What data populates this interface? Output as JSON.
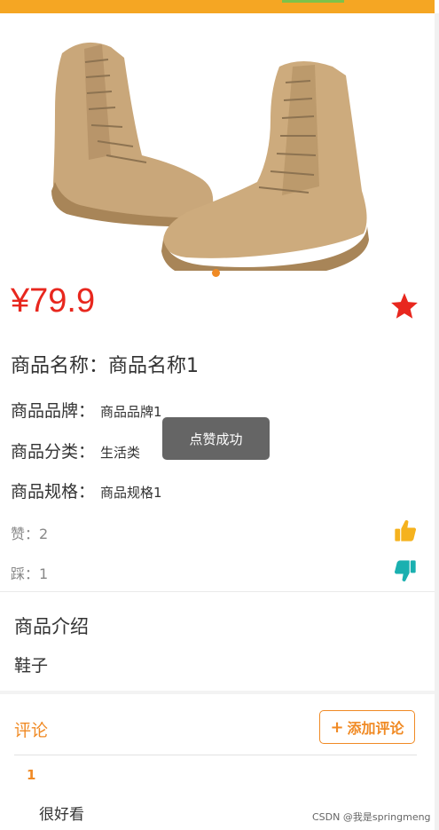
{
  "colors": {
    "accent_orange": "#f08a24",
    "price_red": "#e8271e",
    "like_yellow": "#f5b21e",
    "dislike_teal": "#1ab0b0",
    "star_red": "#e8271e"
  },
  "product": {
    "price": "¥79.9",
    "name_label": "商品名称：",
    "name_value": "商品名称1",
    "brand_label": "商品品牌：",
    "brand_value": "商品品牌1",
    "category_label": "商品分类：",
    "category_value": "生活类",
    "spec_label": "商品规格：",
    "spec_value": "商品规格1"
  },
  "votes": {
    "like_label": "赞：",
    "like_count": "2",
    "dislike_label": "踩：",
    "dislike_count": "1"
  },
  "intro": {
    "title": "商品介绍",
    "text": "鞋子"
  },
  "comments": {
    "title": "评论",
    "add_label": "添加评论",
    "items": [
      {
        "index": "1",
        "text": "很好看"
      }
    ]
  },
  "toast": "点赞成功",
  "watermark": "CSDN @我是springmeng",
  "icons": {
    "favorite": "star-icon",
    "like": "thumbs-up-icon",
    "dislike": "thumbs-down-icon",
    "add": "plus-icon"
  },
  "carousel": {
    "image": "tan desert boots",
    "indicator_count": 1,
    "active_index": 0
  }
}
